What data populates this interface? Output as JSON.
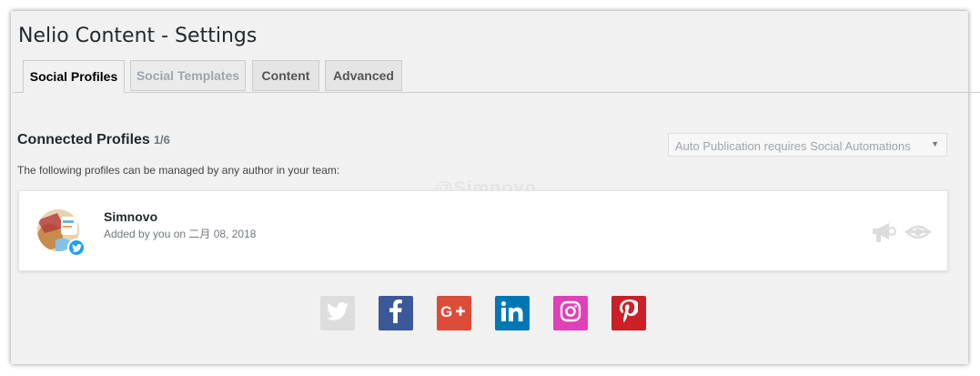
{
  "page": {
    "title": "Nelio Content - Settings"
  },
  "tabs": [
    {
      "label": "Social Profiles",
      "state": "active"
    },
    {
      "label": "Social Templates",
      "state": "disabled"
    },
    {
      "label": "Content",
      "state": "normal"
    },
    {
      "label": "Advanced",
      "state": "normal"
    }
  ],
  "section": {
    "title": "Connected Profiles",
    "count": "1/6",
    "description": "The following profiles can be managed by any author in your team:",
    "select_value": "Auto Publication requires Social Automations",
    "watermark": "@Simnovo"
  },
  "profiles": [
    {
      "name": "Simnovo",
      "added_text": "Added by you on 二月 08, 2018",
      "network": "twitter",
      "network_color": "#1da1f2",
      "icons": [
        "megaphone-icon",
        "visibility-icon"
      ]
    }
  ],
  "networks": [
    {
      "name": "twitter",
      "icon": "twitter-icon",
      "color": "#dddddd",
      "state": "connected"
    },
    {
      "name": "facebook",
      "icon": "facebook-icon",
      "color": "#3b5998"
    },
    {
      "name": "google-plus",
      "icon": "google-plus-icon",
      "color": "#dd4b39"
    },
    {
      "name": "linkedin",
      "icon": "linkedin-icon",
      "color": "#0077b5"
    },
    {
      "name": "instagram",
      "icon": "instagram-icon",
      "color": "#e040b8"
    },
    {
      "name": "pinterest",
      "icon": "pinterest-icon",
      "color": "#cb2027"
    }
  ]
}
